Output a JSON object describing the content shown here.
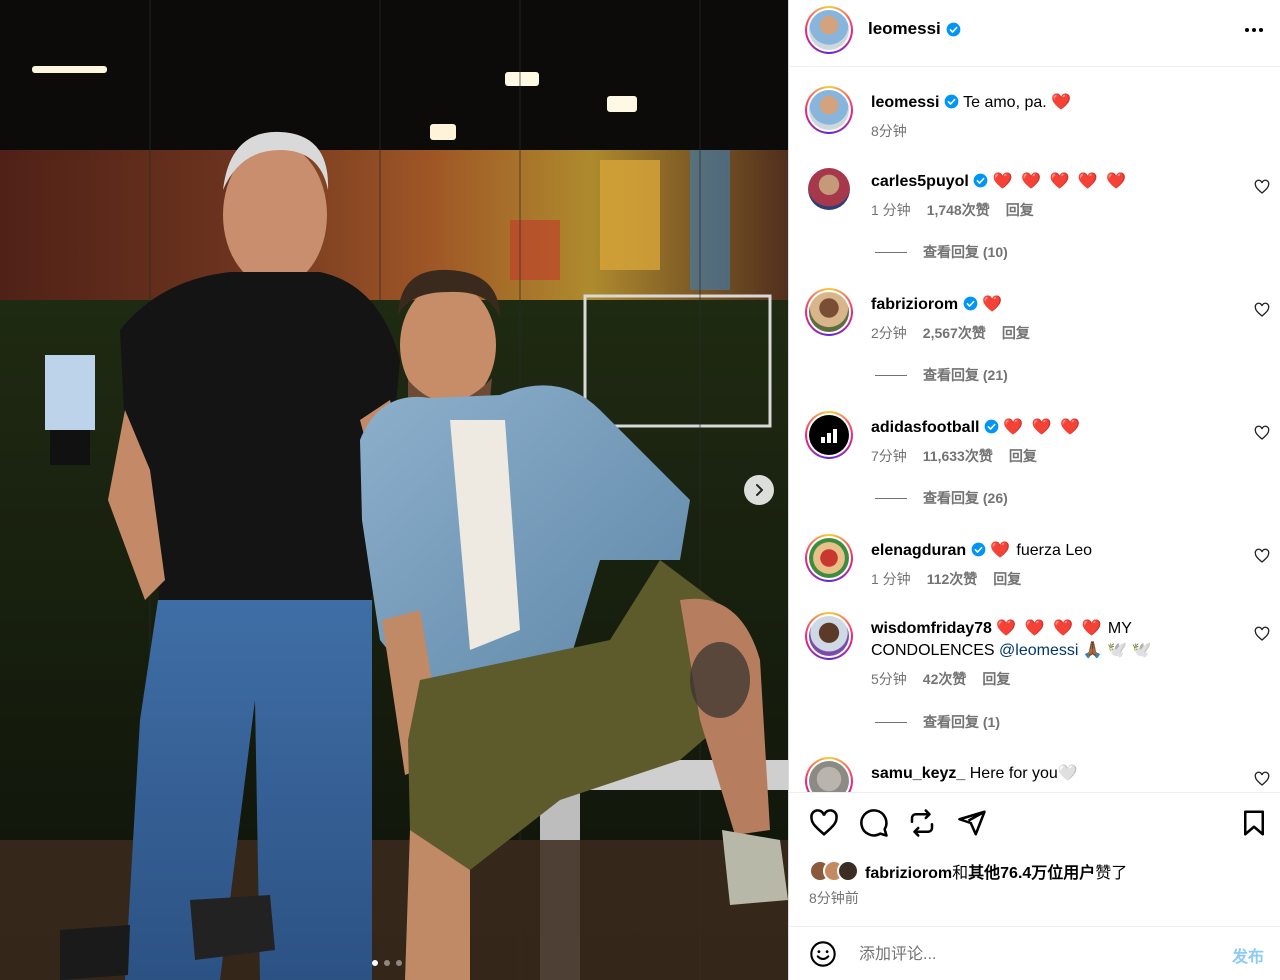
{
  "post": {
    "author": "leomessi",
    "caption": "Te amo, pa. ❤️",
    "caption_time": "8分钟",
    "slide_count": 3,
    "active_slide": 1
  },
  "comments": [
    {
      "user": "carles5puyol",
      "text": "❤️ ❤️ ❤️ ❤️ ❤️",
      "time": "1 分钟",
      "likes": "1,748次赞",
      "reply": "回复",
      "view_replies": "查看回复 (10)"
    },
    {
      "user": "fabriziorom",
      "text": "❤️",
      "time": "2分钟",
      "likes": "2,567次赞",
      "reply": "回复",
      "view_replies": "查看回复 (21)"
    },
    {
      "user": "adidasfootball",
      "text": "❤️ ❤️ ❤️",
      "time": "7分钟",
      "likes": "11,633次赞",
      "reply": "回复",
      "view_replies": "查看回复 (26)"
    },
    {
      "user": "elenagduran",
      "text_prefix": "❤️",
      "text": "fuerza Leo",
      "time": "1 分钟",
      "likes": "112次赞",
      "reply": "回复"
    },
    {
      "user": "wisdomfriday78",
      "text_prefix": "❤️ ❤️ ❤️ ❤️",
      "text": "MY CONDOLENCES",
      "mention": "@leomessi",
      "text_suffix": "🙏🏾 🕊️ 🕊️",
      "time": "5分钟",
      "likes": "42次赞",
      "reply": "回复",
      "view_replies": "查看回复 (1)"
    },
    {
      "user": "samu_keyz_",
      "text": "Here for you🤍"
    }
  ],
  "likes_summary": {
    "first_user": "fabriziorom",
    "connector": "和",
    "others": "其他76.4万位用户",
    "suffix": "赞了"
  },
  "posted_ago": "8分钟前",
  "comment_box": {
    "placeholder": "添加评论...",
    "post_label": "发布"
  },
  "colors": {
    "verified": "#0095f6",
    "heart": "#ed4956",
    "secondary_text": "#737373",
    "post_disabled": "#8ccaf7"
  }
}
